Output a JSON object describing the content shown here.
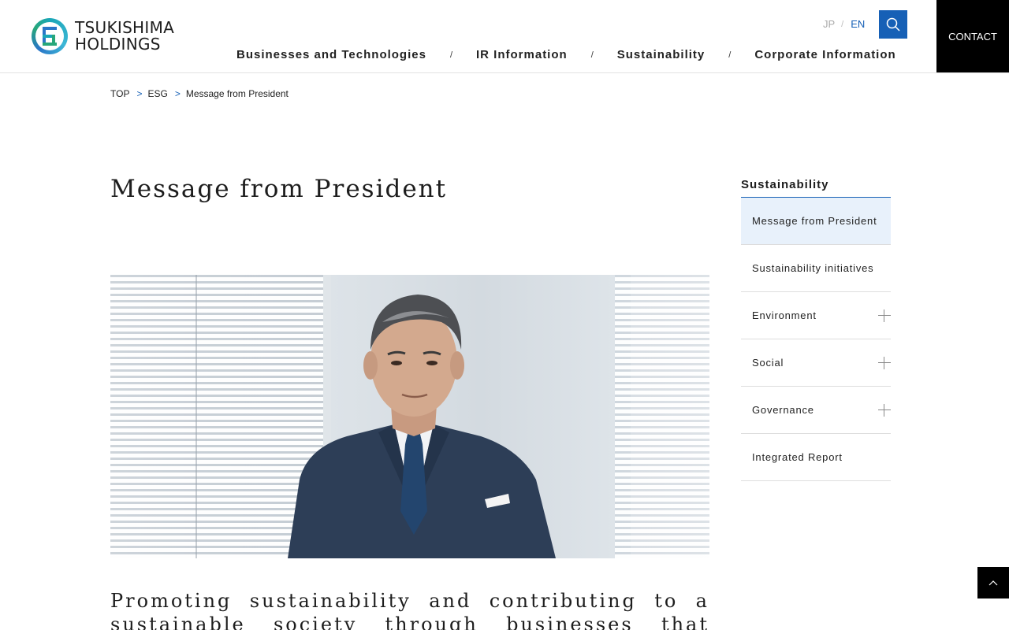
{
  "header": {
    "logo_line1": "TSUKISHIMA",
    "logo_line2": "HOLDINGS",
    "lang_jp": "JP",
    "lang_sep": "/",
    "lang_en": "EN",
    "contact_label": "CONTACT",
    "nav": [
      {
        "label": "Businesses and Technologies"
      },
      {
        "label": "IR Information"
      },
      {
        "label": "Sustainability"
      },
      {
        "label": "Corporate Information"
      }
    ],
    "nav_sep": "/"
  },
  "breadcrumb": {
    "items": [
      "TOP",
      "ESG",
      "Message from President"
    ],
    "separator": ">"
  },
  "page_title": "Message from President",
  "lead_text": "Promoting sustainability and contributing to a sustainable society through businesses that create",
  "sidebar": {
    "title": "Sustainability",
    "items": [
      {
        "label": "Message from President",
        "active": true,
        "expandable": false
      },
      {
        "label": "Sustainability initiatives",
        "active": false,
        "expandable": false
      },
      {
        "label": "Environment",
        "active": false,
        "expandable": true
      },
      {
        "label": "Social",
        "active": false,
        "expandable": true
      },
      {
        "label": "Governance",
        "active": false,
        "expandable": true
      },
      {
        "label": "Integrated Report",
        "active": false,
        "expandable": false
      }
    ]
  },
  "colors": {
    "accent": "#1660b6",
    "active_bg": "#e8f1fb",
    "contact_bg": "#000000"
  },
  "icons": {
    "search": "search-icon",
    "page_top": "chevron-up-icon",
    "expand": "plus-icon"
  }
}
